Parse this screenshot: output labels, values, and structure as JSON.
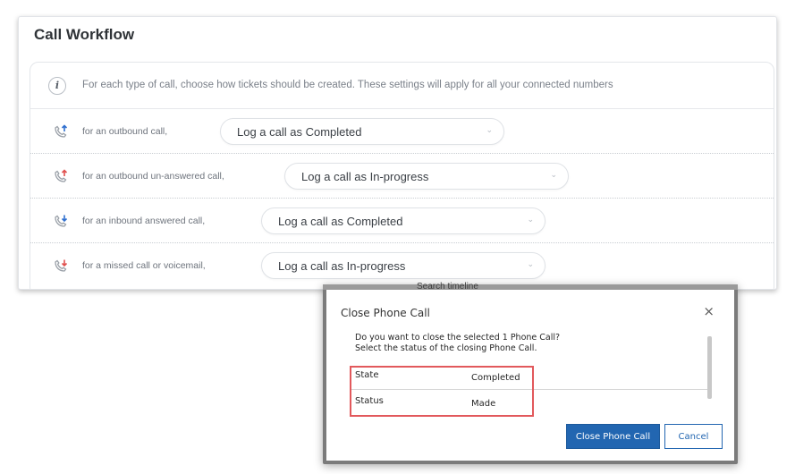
{
  "workflow": {
    "title": "Call Workflow",
    "info_text": "For each type of call, choose how tickets should be created. These settings will apply for all your connected numbers",
    "rows": [
      {
        "label": "for an outbound call,",
        "value": "Log a call as Completed",
        "icon": "outbound-call-icon"
      },
      {
        "label": "for an outbound un-answered call,",
        "value": "Log a call as In-progress",
        "icon": "outbound-unanswered-call-icon"
      },
      {
        "label": "for an inbound answered call,",
        "value": "Log a call as Completed",
        "icon": "inbound-answered-call-icon"
      },
      {
        "label": "for a missed call or voicemail,",
        "value": "Log a call as In-progress",
        "icon": "missed-call-icon"
      }
    ],
    "colors": {
      "outbound": "#2f6fcf",
      "unanswered": "#e0504e",
      "inbound": "#2f6fcf",
      "missed": "#e0504e"
    }
  },
  "background": {
    "search_text": "Search timeline"
  },
  "dialog": {
    "title": "Close Phone Call",
    "close_glyph": "×",
    "message_line1": "Do you want to close the selected 1 Phone Call?",
    "message_line2": "Select the status of the closing Phone Call.",
    "fields": [
      {
        "label": "State",
        "value": "Completed"
      },
      {
        "label": "Status",
        "value": "Made"
      }
    ],
    "primary_button": "Close Phone Call",
    "secondary_button": "Cancel",
    "highlight_color": "#e2595c",
    "primary_color": "#2266b1"
  }
}
